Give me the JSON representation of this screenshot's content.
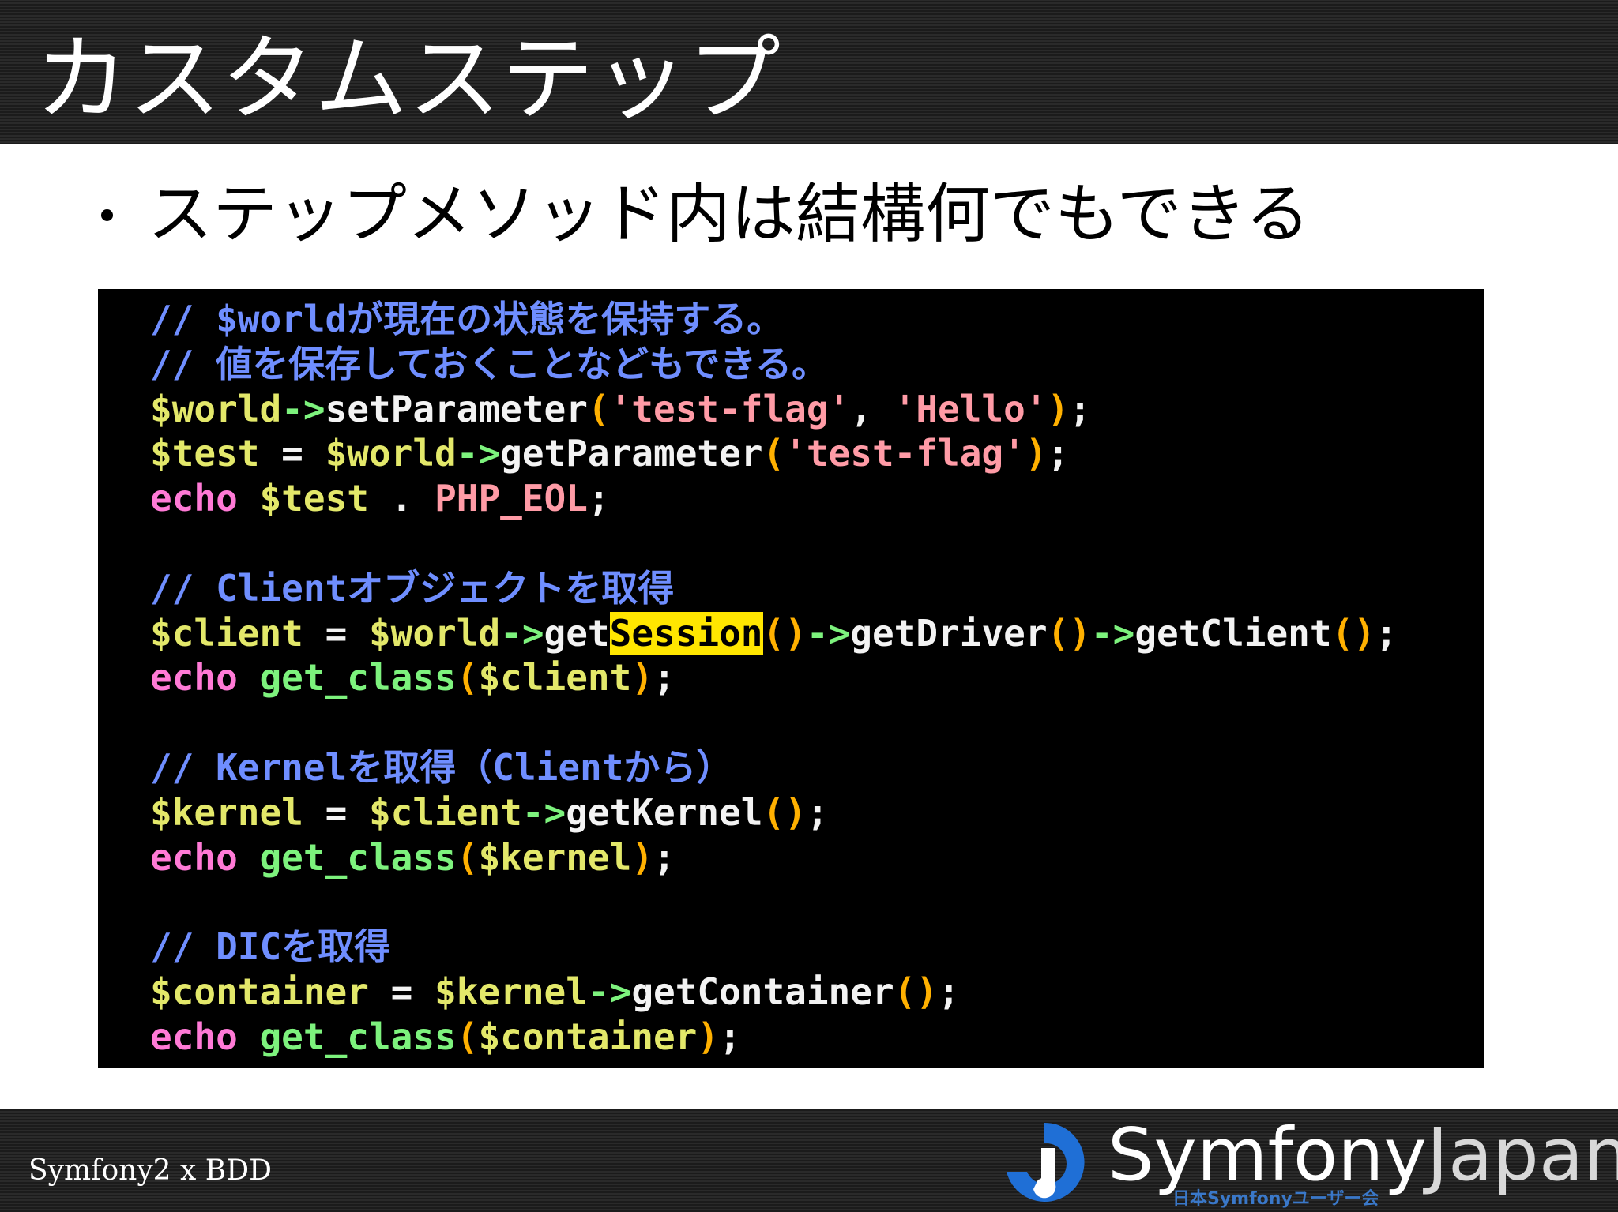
{
  "slide": {
    "title": "カスタムステップ",
    "bullet": "ステップメソッド内は結構何でもできる"
  },
  "code_lines": [
    [
      {
        "t": "// $worldが現在の状態を保持する。",
        "c": "comment"
      }
    ],
    [
      {
        "t": "// 値を保存しておくことなどもできる。",
        "c": "comment"
      }
    ],
    [
      {
        "t": "$world",
        "c": "var"
      },
      {
        "t": "->",
        "c": "op"
      },
      {
        "t": "setParameter",
        "c": "fn"
      },
      {
        "t": "(",
        "c": "paren"
      },
      {
        "t": "'test-flag'",
        "c": "str"
      },
      {
        "t": ", ",
        "c": "plain"
      },
      {
        "t": "'Hello'",
        "c": "str"
      },
      {
        "t": ")",
        "c": "paren"
      },
      {
        "t": ";",
        "c": "plain"
      }
    ],
    [
      {
        "t": "$test",
        "c": "var"
      },
      {
        "t": " = ",
        "c": "plain"
      },
      {
        "t": "$world",
        "c": "var"
      },
      {
        "t": "->",
        "c": "op"
      },
      {
        "t": "getParameter",
        "c": "fn"
      },
      {
        "t": "(",
        "c": "paren"
      },
      {
        "t": "'test-flag'",
        "c": "str"
      },
      {
        "t": ")",
        "c": "paren"
      },
      {
        "t": ";",
        "c": "plain"
      }
    ],
    [
      {
        "t": "echo",
        "c": "kw"
      },
      {
        "t": " ",
        "c": "plain"
      },
      {
        "t": "$test",
        "c": "var"
      },
      {
        "t": " . ",
        "c": "plain"
      },
      {
        "t": "PHP_EOL",
        "c": "const"
      },
      {
        "t": ";",
        "c": "plain"
      }
    ],
    [],
    [
      {
        "t": "// Clientオブジェクトを取得",
        "c": "comment"
      }
    ],
    [
      {
        "t": "$client",
        "c": "var"
      },
      {
        "t": " = ",
        "c": "plain"
      },
      {
        "t": "$world",
        "c": "var"
      },
      {
        "t": "->",
        "c": "op"
      },
      {
        "t": "get",
        "c": "fn"
      },
      {
        "t": "Session",
        "c": "hl"
      },
      {
        "t": "()",
        "c": "paren"
      },
      {
        "t": "->",
        "c": "op"
      },
      {
        "t": "getDriver",
        "c": "fn"
      },
      {
        "t": "()",
        "c": "paren"
      },
      {
        "t": "->",
        "c": "op"
      },
      {
        "t": "getClient",
        "c": "fn"
      },
      {
        "t": "()",
        "c": "paren"
      },
      {
        "t": ";",
        "c": "plain"
      }
    ],
    [
      {
        "t": "echo",
        "c": "kw"
      },
      {
        "t": " ",
        "c": "plain"
      },
      {
        "t": "get_class",
        "c": "builtin"
      },
      {
        "t": "(",
        "c": "paren"
      },
      {
        "t": "$client",
        "c": "var"
      },
      {
        "t": ")",
        "c": "paren"
      },
      {
        "t": ";",
        "c": "plain"
      }
    ],
    [],
    [
      {
        "t": "// Kernelを取得（Clientから）",
        "c": "comment"
      }
    ],
    [
      {
        "t": "$kernel",
        "c": "var"
      },
      {
        "t": " = ",
        "c": "plain"
      },
      {
        "t": "$client",
        "c": "var"
      },
      {
        "t": "->",
        "c": "op"
      },
      {
        "t": "getKernel",
        "c": "fn"
      },
      {
        "t": "()",
        "c": "paren"
      },
      {
        "t": ";",
        "c": "plain"
      }
    ],
    [
      {
        "t": "echo",
        "c": "kw"
      },
      {
        "t": " ",
        "c": "plain"
      },
      {
        "t": "get_class",
        "c": "builtin"
      },
      {
        "t": "(",
        "c": "paren"
      },
      {
        "t": "$kernel",
        "c": "var"
      },
      {
        "t": ")",
        "c": "paren"
      },
      {
        "t": ";",
        "c": "plain"
      }
    ],
    [],
    [
      {
        "t": "// DICを取得",
        "c": "comment"
      }
    ],
    [
      {
        "t": "$container",
        "c": "var"
      },
      {
        "t": " = ",
        "c": "plain"
      },
      {
        "t": "$kernel",
        "c": "var"
      },
      {
        "t": "->",
        "c": "op"
      },
      {
        "t": "getContainer",
        "c": "fn"
      },
      {
        "t": "()",
        "c": "paren"
      },
      {
        "t": ";",
        "c": "plain"
      }
    ],
    [
      {
        "t": "echo",
        "c": "kw"
      },
      {
        "t": " ",
        "c": "plain"
      },
      {
        "t": "get_class",
        "c": "builtin"
      },
      {
        "t": "(",
        "c": "paren"
      },
      {
        "t": "$container",
        "c": "var"
      },
      {
        "t": ")",
        "c": "paren"
      },
      {
        "t": ";",
        "c": "plain"
      }
    ]
  ],
  "footer": {
    "text": "Symfony2 x BDD",
    "logo_main": "Symfony",
    "logo_secondary": "Japan",
    "logo_sub": "日本Symfonyユーザー会",
    "logo_icon": "symfony-japan-logo-icon",
    "logo_colors": {
      "blue": "#1f6fd6",
      "white": "#ffffff"
    }
  },
  "colors": {
    "comment": "#6f8eff",
    "variable": "#e3e86a",
    "operator": "#7df27d",
    "string": "#ff9ba6",
    "keyword": "#ff7ad6",
    "paren": "#ffb000",
    "highlight": "#ffe600"
  }
}
